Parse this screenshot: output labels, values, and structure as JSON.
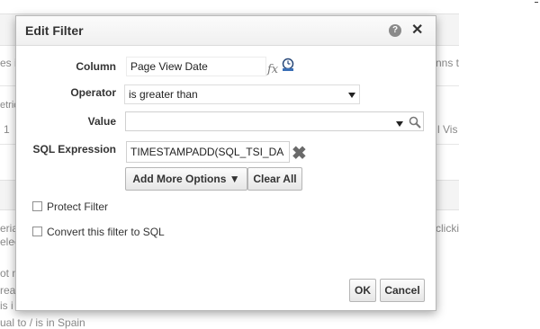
{
  "background": {
    "fragments": [
      "es i",
      "etric",
      "1",
      "eria",
      "elect",
      "ot m",
      "reat",
      "is i",
      "ual to / is in  Spain",
      "nns t",
      "l Vis",
      "clicki"
    ]
  },
  "dialog": {
    "title": "Edit Filter",
    "help_icon": "?",
    "close_icon": "✕",
    "column": {
      "label": "Column",
      "value": "Page View Date",
      "fx_glyph": "fx"
    },
    "operator": {
      "label": "Operator",
      "value": "is greater than"
    },
    "value_field": {
      "label": "Value",
      "value": ""
    },
    "sql_expression": {
      "label": "SQL Expression",
      "value": "TIMESTAMPADD(SQL_TSI_DA",
      "clear_glyph": "✖"
    },
    "buttons": {
      "add_more_options": "Add More Options ▼",
      "clear_all": "Clear All",
      "ok": "OK",
      "cancel": "Cancel"
    },
    "checkboxes": {
      "protect_filter": {
        "label": "Protect Filter",
        "checked": false
      },
      "convert_to_sql": {
        "label": "Convert this filter to SQL",
        "checked": false
      }
    }
  }
}
